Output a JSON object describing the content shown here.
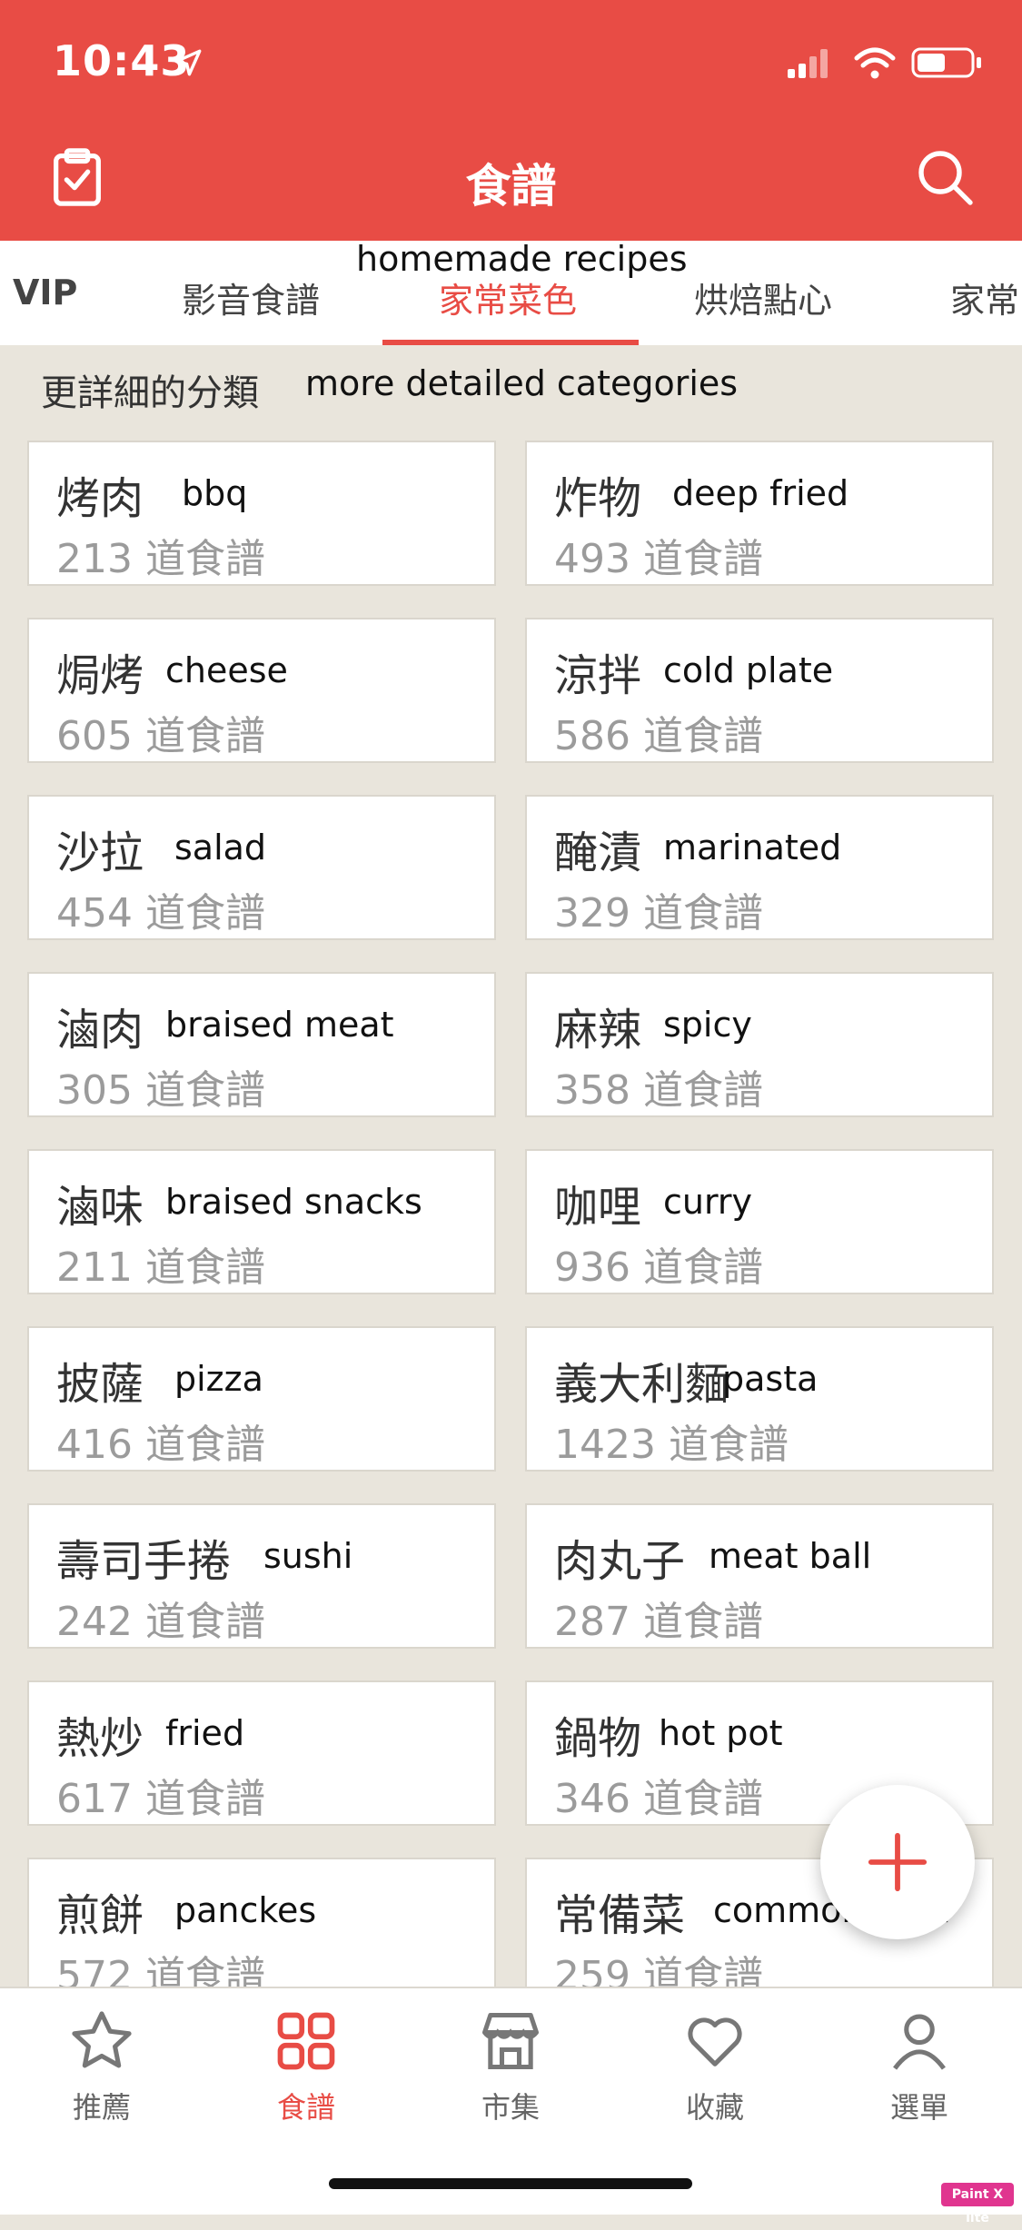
{
  "status": {
    "time": "10:43"
  },
  "header": {
    "title": "食譜"
  },
  "tabs": [
    {
      "label": "VIP"
    },
    {
      "label": "影音食譜"
    },
    {
      "label": "家常菜色",
      "annotation": "homemade recipes",
      "active": true
    },
    {
      "label": "烘焙點心"
    },
    {
      "label": "家常"
    }
  ],
  "section": {
    "title": "更詳細的分類",
    "annotation": "more detailed categories"
  },
  "cards": [
    {
      "name": "烤肉",
      "annotation": "bbq",
      "count": "213 道食譜"
    },
    {
      "name": "炸物",
      "annotation": "deep fried",
      "count": "493 道食譜"
    },
    {
      "name": "焗烤",
      "annotation": "cheese",
      "count": "605 道食譜"
    },
    {
      "name": "涼拌",
      "annotation": "cold plate",
      "count": "586 道食譜"
    },
    {
      "name": "沙拉",
      "annotation": "salad",
      "count": "454 道食譜"
    },
    {
      "name": "醃漬",
      "annotation": "marinated",
      "count": "329 道食譜"
    },
    {
      "name": "滷肉",
      "annotation": "braised meat",
      "count": "305 道食譜"
    },
    {
      "name": "麻辣",
      "annotation": "spicy",
      "count": "358 道食譜"
    },
    {
      "name": "滷味",
      "annotation": "braised snacks",
      "count": "211 道食譜"
    },
    {
      "name": "咖哩",
      "annotation": "curry",
      "count": "936 道食譜"
    },
    {
      "name": "披薩",
      "annotation": "pizza",
      "count": "416 道食譜"
    },
    {
      "name": "義大利麵",
      "annotation": "pasta",
      "count": "1423 道食譜"
    },
    {
      "name": "壽司手捲",
      "annotation": "sushi",
      "count": "242 道食譜"
    },
    {
      "name": "肉丸子",
      "annotation": "meat ball",
      "count": "287 道食譜"
    },
    {
      "name": "熱炒",
      "annotation": "fried",
      "count": "617 道食譜"
    },
    {
      "name": "鍋物",
      "annotation": "hot pot",
      "count": "346 道食譜"
    },
    {
      "name": "煎餅",
      "annotation": "panckes",
      "count": "572 道食譜"
    },
    {
      "name": "常備菜",
      "annotation": "common food",
      "count": "259 道食譜"
    }
  ],
  "bottom_nav": [
    {
      "label": "推薦",
      "icon": "star-icon"
    },
    {
      "label": "食譜",
      "icon": "grid-icon",
      "active": true
    },
    {
      "label": "市集",
      "icon": "store-icon"
    },
    {
      "label": "收藏",
      "icon": "heart-icon"
    },
    {
      "label": "選單",
      "icon": "person-icon"
    }
  ],
  "watermark": "Paint X lite",
  "colors": {
    "accent": "#e84c45",
    "background": "#e9e5dc"
  }
}
